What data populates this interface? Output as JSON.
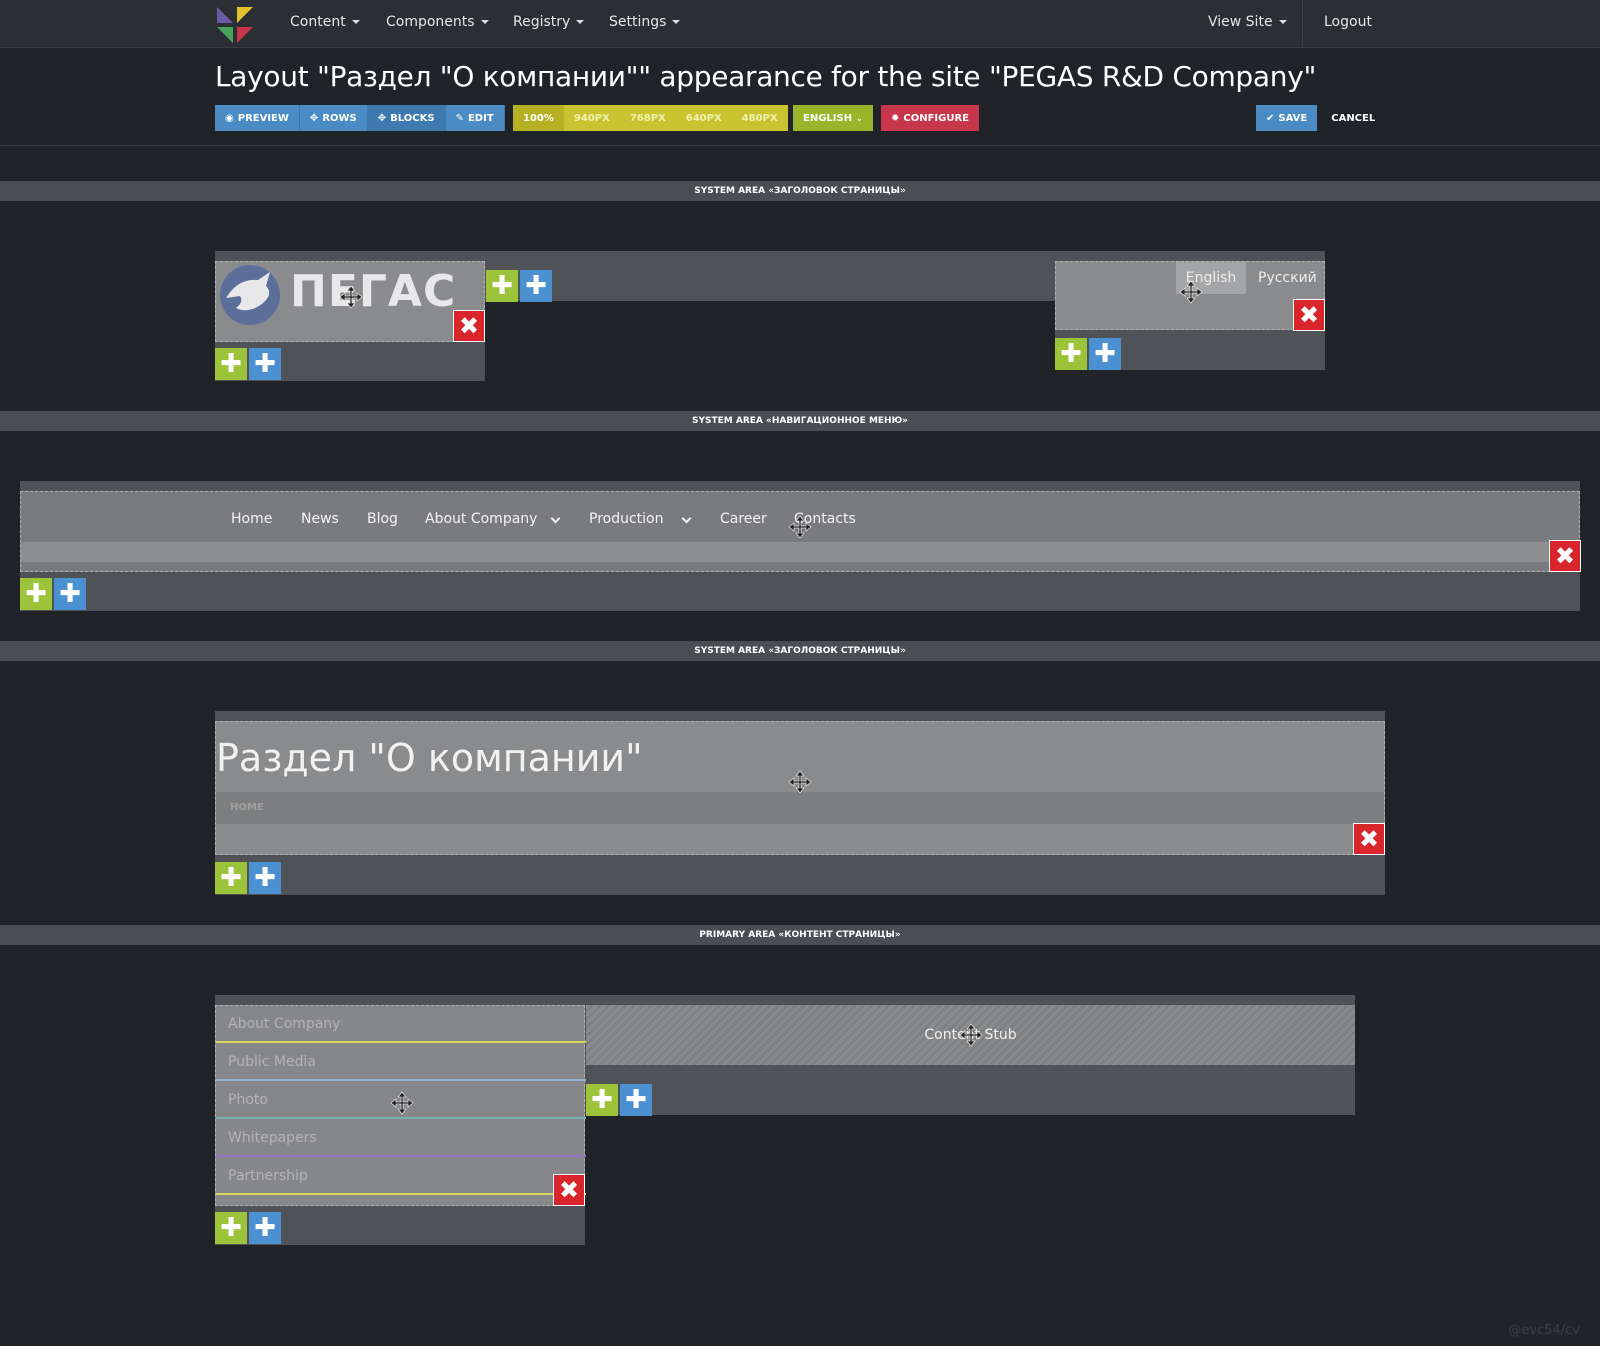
{
  "nav": {
    "items": [
      {
        "label": "Content"
      },
      {
        "label": "Components"
      },
      {
        "label": "Registry"
      },
      {
        "label": "Settings"
      }
    ],
    "view_site": "View Site",
    "logout": "Logout"
  },
  "title": "Layout \"Раздел \"О компании\"\" appearance for the site \"PEGAS R&D Company\"",
  "toolbar": {
    "preview": "PREVIEW",
    "rows": "ROWS",
    "blocks": "BLOCKS",
    "edit": "EDIT",
    "widths": [
      "100%",
      "940PX",
      "768PX",
      "640PX",
      "480PX"
    ],
    "language": "ENGLISH",
    "configure": "CONFIGURE",
    "save": "SAVE",
    "cancel": "CANCEL"
  },
  "areas": {
    "header": "SYSTEM AREA «ЗАГОЛОВОК СТРАНИЦЫ»",
    "nav": "SYSTEM AREA «НАВИГАЦИОННОЕ МЕНЮ»",
    "title": "SYSTEM AREA «ЗАГОЛОВОК СТРАНИЦЫ»",
    "primary": "PRIMARY AREA «КОНТЕНТ СТРАНИЦЫ»"
  },
  "header_block": {
    "logo_text": "ПЕГАС",
    "languages": [
      "English",
      "Русский"
    ]
  },
  "menu": {
    "items": [
      "Home",
      "News",
      "Blog",
      "About Company",
      "Production",
      "Career",
      "Contacts"
    ]
  },
  "title_block": {
    "heading": "Раздел \"О компании\"",
    "breadcrumb": "HOME"
  },
  "sidebar": {
    "items": [
      "About Company",
      "Public Media",
      "Photo",
      "Whitepapers",
      "Partnership"
    ]
  },
  "content_stub": "Content Stub",
  "watermark": "@evc54/cv",
  "colors": {
    "background": "#202327",
    "navbar": "#2b2f34",
    "add_green": "#9dc33a",
    "add_blue": "#4b90d0",
    "delete_red": "#d8262c",
    "configure_red": "#c8364c",
    "width_yellow": "#c9c32f",
    "language_green": "#9ab52a"
  }
}
